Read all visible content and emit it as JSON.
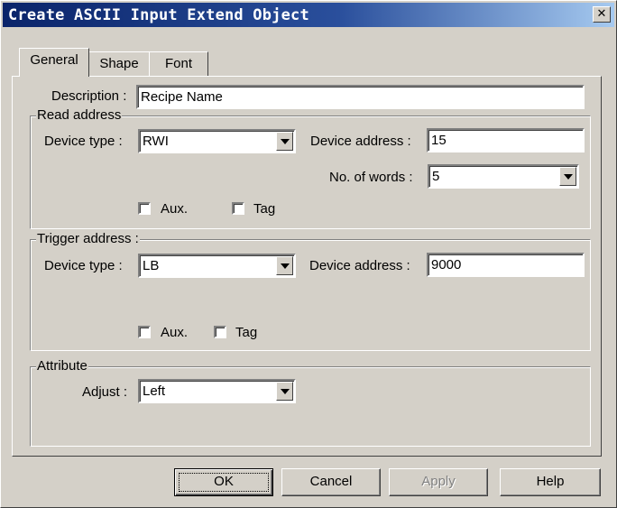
{
  "window": {
    "title": "Create ASCII Input Extend  Object",
    "close_glyph": "✕"
  },
  "tabs": [
    {
      "label": "General",
      "active": true
    },
    {
      "label": "Shape",
      "active": false
    },
    {
      "label": "Font",
      "active": false
    }
  ],
  "general": {
    "description_label": "Description :",
    "description_value": "Recipe Name"
  },
  "read_address": {
    "legend": "Read address",
    "device_type_label": "Device type :",
    "device_type_value": "RWI",
    "device_address_label": "Device address :",
    "device_address_value": "15",
    "no_of_words_label": "No. of words :",
    "no_of_words_value": "5",
    "aux_label": "Aux.",
    "aux_checked": false,
    "tag_label": "Tag",
    "tag_checked": false
  },
  "trigger_address": {
    "legend": "Trigger address :",
    "device_type_label": "Device type :",
    "device_type_value": "LB",
    "device_address_label": "Device  address :",
    "device_address_value": "9000",
    "aux_label": "Aux.",
    "aux_checked": false,
    "tag_label": "Tag",
    "tag_checked": false
  },
  "attribute": {
    "legend": "Attribute",
    "adjust_label": "Adjust :",
    "adjust_value": "Left"
  },
  "buttons": {
    "ok": "OK",
    "cancel": "Cancel",
    "apply": "Apply",
    "help": "Help"
  },
  "colors": {
    "title_gradient_start": "#0a246a",
    "title_gradient_end": "#a6caf0",
    "face": "#d4d0c8"
  }
}
